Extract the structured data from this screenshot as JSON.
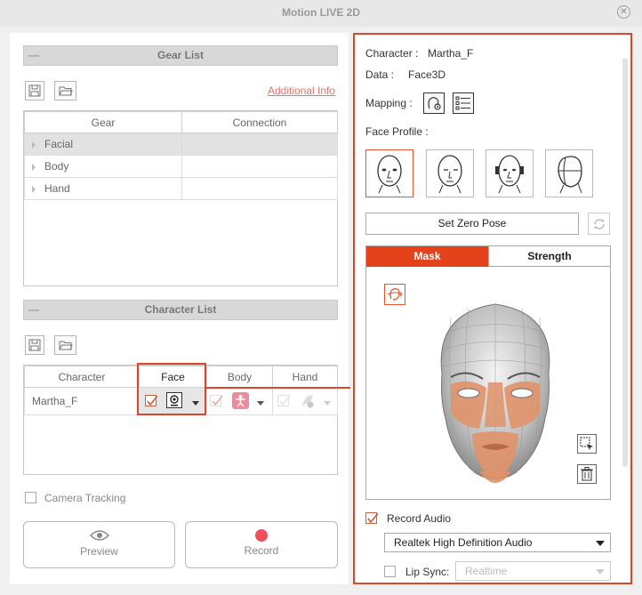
{
  "window": {
    "title": "Motion LIVE 2D",
    "close_glyph": "✕"
  },
  "gear_list": {
    "header": "Gear List",
    "collapse_glyph": "—",
    "additional_info": "Additional Info",
    "columns": [
      "Gear",
      "Connection"
    ],
    "rows": [
      {
        "gear": "Facial",
        "connection": ""
      },
      {
        "gear": "Body",
        "connection": ""
      },
      {
        "gear": "Hand",
        "connection": ""
      }
    ]
  },
  "character_list": {
    "header": "Character List",
    "collapse_glyph": "—",
    "columns": [
      "Character",
      "Face",
      "Body",
      "Hand"
    ],
    "rows": [
      {
        "character": "Martha_F"
      }
    ]
  },
  "camera_tracking": {
    "label": "Camera Tracking"
  },
  "buttons": {
    "preview": "Preview",
    "record": "Record"
  },
  "right": {
    "character_label": "Character :",
    "character_value": "Martha_F",
    "data_label": "Data :",
    "data_value": "Face3D",
    "mapping_label": "Mapping :",
    "face_profile_label": "Face Profile :",
    "set_zero_pose": "Set Zero Pose",
    "tabs": {
      "mask": "Mask",
      "strength": "Strength"
    },
    "record_audio": "Record Audio",
    "audio_device": "Realtek High Definition Audio",
    "lip_sync_label": "Lip Sync:",
    "lip_sync_value": "Realtime"
  },
  "colors": {
    "accent": "#e3572f",
    "highlight_border": "#d9482b",
    "link": "#e4736a",
    "record_dot": "#f0505a",
    "mask": "#e0926a"
  }
}
